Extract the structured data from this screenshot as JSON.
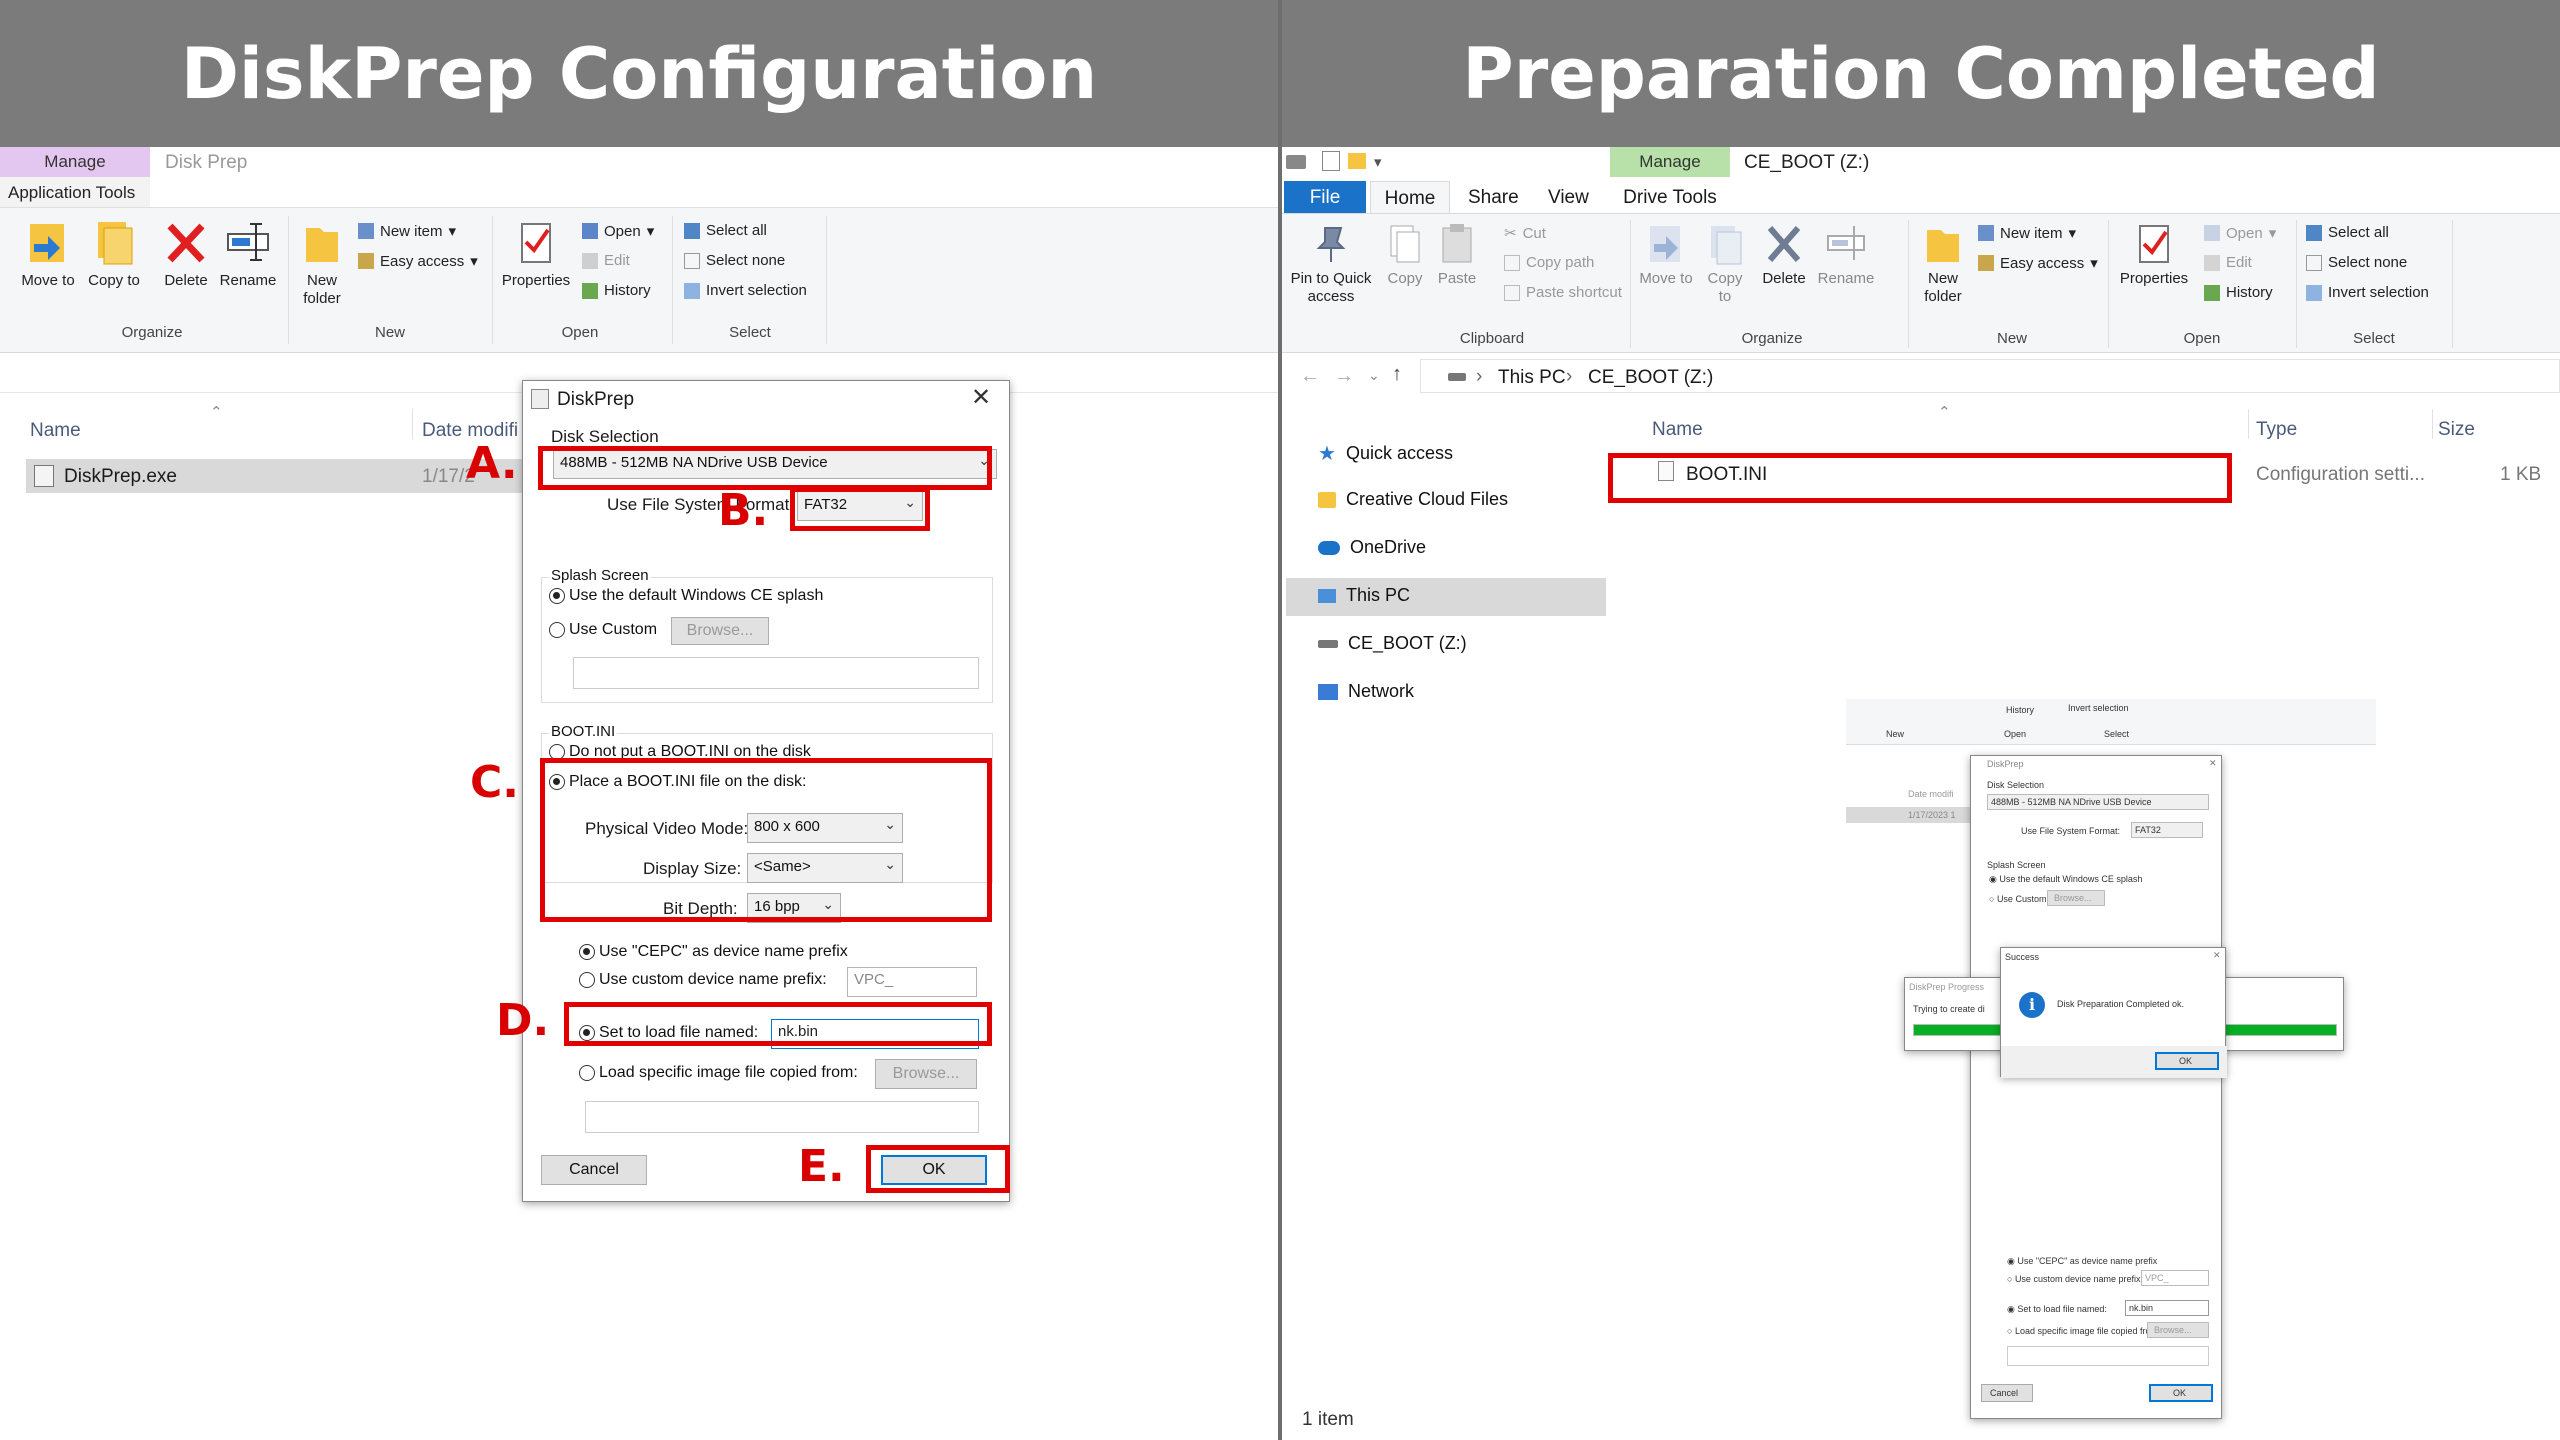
{
  "left": {
    "banner": "DiskPrep Configuration",
    "ribbon": {
      "context_tab": "Manage",
      "context_title": "Disk Prep",
      "tools_tab": "Application Tools",
      "move_to": "Move to",
      "copy_to": "Copy to",
      "delete": "Delete",
      "rename": "Rename",
      "new_folder": "New folder",
      "new_item": "New item",
      "easy_access": "Easy access",
      "properties": "Properties",
      "open": "Open",
      "edit": "Edit",
      "history": "History",
      "select_all": "Select all",
      "select_none": "Select none",
      "invert_selection": "Invert selection",
      "group_organize": "Organize",
      "group_new": "New",
      "group_open": "Open",
      "group_select": "Select"
    },
    "files": {
      "col_name": "Name",
      "col_date": "Date modifi",
      "row_name": "DiskPrep.exe",
      "row_date": "1/17/2"
    },
    "dialog": {
      "title": "DiskPrep",
      "disk_selection_label": "Disk Selection",
      "disk_value": "488MB - 512MB NA NDrive USB Device",
      "fs_label": "Use File System Format:",
      "fs_value": "FAT32",
      "splash_group": "Splash Screen",
      "splash_default": "Use the default Windows CE splash",
      "splash_custom": "Use Custom",
      "browse": "Browse...",
      "bootini_group": "BOOT.INI",
      "no_bootini": "Do not put a BOOT.INI on the disk",
      "place_bootini": "Place a BOOT.INI file on the disk:",
      "video_mode_label": "Physical Video Mode:",
      "video_mode_value": "800 x 600",
      "display_size_label": "Display Size:",
      "display_size_value": "<Same>",
      "bit_depth_label": "Bit Depth:",
      "bit_depth_value": "16 bpp",
      "cepc_prefix": "Use \"CEPC\" as device name prefix",
      "custom_prefix": "Use custom device name prefix:",
      "custom_prefix_value": "VPC_",
      "load_file_label": "Set to load file named:",
      "load_file_value": "nk.bin",
      "load_image_label": "Load specific image file copied from:",
      "cancel": "Cancel",
      "ok": "OK"
    },
    "annotations": {
      "a": "A.",
      "b": "B.",
      "c": "C.",
      "d": "D.",
      "e": "E."
    }
  },
  "right": {
    "banner": "Preparation Completed",
    "titlebar": {
      "manage_tab": "Manage",
      "drive_title": "CE_BOOT (Z:)"
    },
    "tabs": {
      "file": "File",
      "home": "Home",
      "share": "Share",
      "view": "View",
      "drive_tools": "Drive Tools"
    },
    "ribbon": {
      "pin": "Pin to Quick access",
      "copy": "Copy",
      "paste": "Paste",
      "cut": "Cut",
      "copy_path": "Copy path",
      "paste_shortcut": "Paste shortcut",
      "move_to": "Move to",
      "copy_to": "Copy to",
      "delete": "Delete",
      "rename": "Rename",
      "new_folder": "New folder",
      "new_item": "New item",
      "easy_access": "Easy access",
      "properties": "Properties",
      "open": "Open",
      "edit": "Edit",
      "history": "History",
      "select_all": "Select all",
      "select_none": "Select none",
      "invert_selection": "Invert selection",
      "group_clipboard": "Clipboard",
      "group_organize": "Organize",
      "group_new": "New",
      "group_open": "Open",
      "group_select": "Select"
    },
    "address": {
      "this_pc": "This PC",
      "drive": "CE_BOOT (Z:)"
    },
    "nav": {
      "quick_access": "Quick access",
      "creative_cloud": "Creative Cloud Files",
      "onedrive": "OneDrive",
      "this_pc": "This PC",
      "ce_boot": "CE_BOOT (Z:)",
      "network": "Network"
    },
    "files": {
      "col_name": "Name",
      "col_type": "Type",
      "col_size": "Size",
      "row_name": "BOOT.INI",
      "row_type": "Configuration setti...",
      "row_size": "1 KB"
    },
    "status": "1 item",
    "inset": {
      "ribbon_history": "History",
      "ribbon_invert": "Invert selection",
      "ribbon_new": "New",
      "ribbon_open": "Open",
      "ribbon_select": "Select",
      "date_col": "Date modifi",
      "date_row": "1/17/2023 1",
      "dialog_title": "DiskPrep",
      "disk_selection": "Disk Selection",
      "disk_value": "488MB - 512MB NA NDrive USB Device",
      "fs_label": "Use File System Format:",
      "fs_value": "FAT32",
      "splash_group": "Splash Screen",
      "splash_default": "Use the default Windows CE splash",
      "splash_custom": "Use Custom",
      "browse": "Browse...",
      "progress_title": "DiskPrep Progress",
      "progress_text": "Trying to create di",
      "success_title": "Success",
      "success_message": "Disk Preparation Completed ok.",
      "success_ok": "OK",
      "cepc_prefix": "Use \"CEPC\" as device name prefix",
      "custom_prefix": "Use custom device name prefix:",
      "custom_prefix_value": "VPC_",
      "load_file_label": "Set to load file named:",
      "load_file_value": "nk.bin",
      "load_image_label": "Load specific image file copied from:",
      "cancel": "Cancel",
      "ok": "OK"
    }
  },
  "colors": {
    "banner_bg": "#7b7b7b",
    "highlight_red": "#e00000",
    "manage_tab_left": "#e4c7f0",
    "manage_tab_right": "#b7e1a8",
    "file_tab": "#1a73c8",
    "selected_nav": "#d9d9d9",
    "progress_green": "#06b025"
  }
}
